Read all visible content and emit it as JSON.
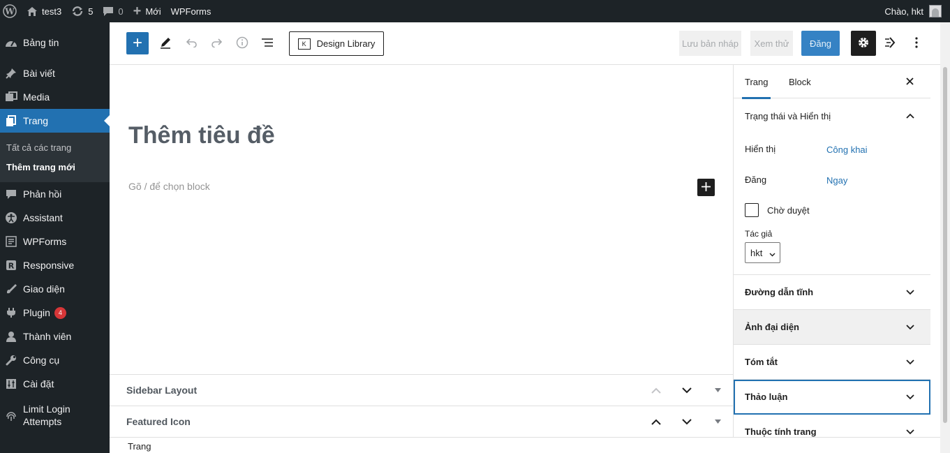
{
  "adminbar": {
    "site_name": "test3",
    "updates_count": "5",
    "comments_count": "0",
    "new_label": "Mới",
    "wpforms_label": "WPForms",
    "greeting": "Chào, hkt"
  },
  "menu": {
    "dashboard": "Bảng tin",
    "posts": "Bài viết",
    "media": "Media",
    "pages": "Trang",
    "pages_sub_all": "Tất cả các trang",
    "pages_sub_new": "Thêm trang mới",
    "comments": "Phản hồi",
    "assistant": "Assistant",
    "wpforms": "WPForms",
    "responsive": "Responsive",
    "appearance": "Giao diện",
    "plugins": "Plugin",
    "plugins_badge": "4",
    "users": "Thành viên",
    "tools": "Công cụ",
    "settings": "Cài đặt",
    "limit_login": "Limit Login Attempts"
  },
  "toolbar": {
    "design_library": "Design Library",
    "save_draft": "Lưu bản nháp",
    "preview": "Xem thử",
    "publish": "Đăng"
  },
  "editor": {
    "title_placeholder": "Thêm tiêu đề",
    "block_placeholder": "Gõ / để chọn block"
  },
  "metaboxes": [
    {
      "title": "Sidebar Layout"
    },
    {
      "title": "Featured Icon"
    }
  ],
  "breadcrumb": "Trang",
  "sidebar": {
    "tabs": [
      "Trang",
      "Block"
    ],
    "status_panel": {
      "title": "Trạng thái và Hiển thị",
      "visibility_label": "Hiển thị",
      "visibility_value": "Công khai",
      "publish_label": "Đăng",
      "publish_value": "Ngay",
      "pending_label": "Chờ duyệt",
      "author_label": "Tác giả",
      "author_value": "hkt"
    },
    "panels": [
      "Đường dẫn tĩnh",
      "Ảnh đại diện",
      "Tóm tắt",
      "Thảo luận",
      "Thuộc tính trang"
    ]
  },
  "colors": {
    "admin_dark": "#1d2327",
    "accent": "#2271b1",
    "badge": "#d63638"
  }
}
